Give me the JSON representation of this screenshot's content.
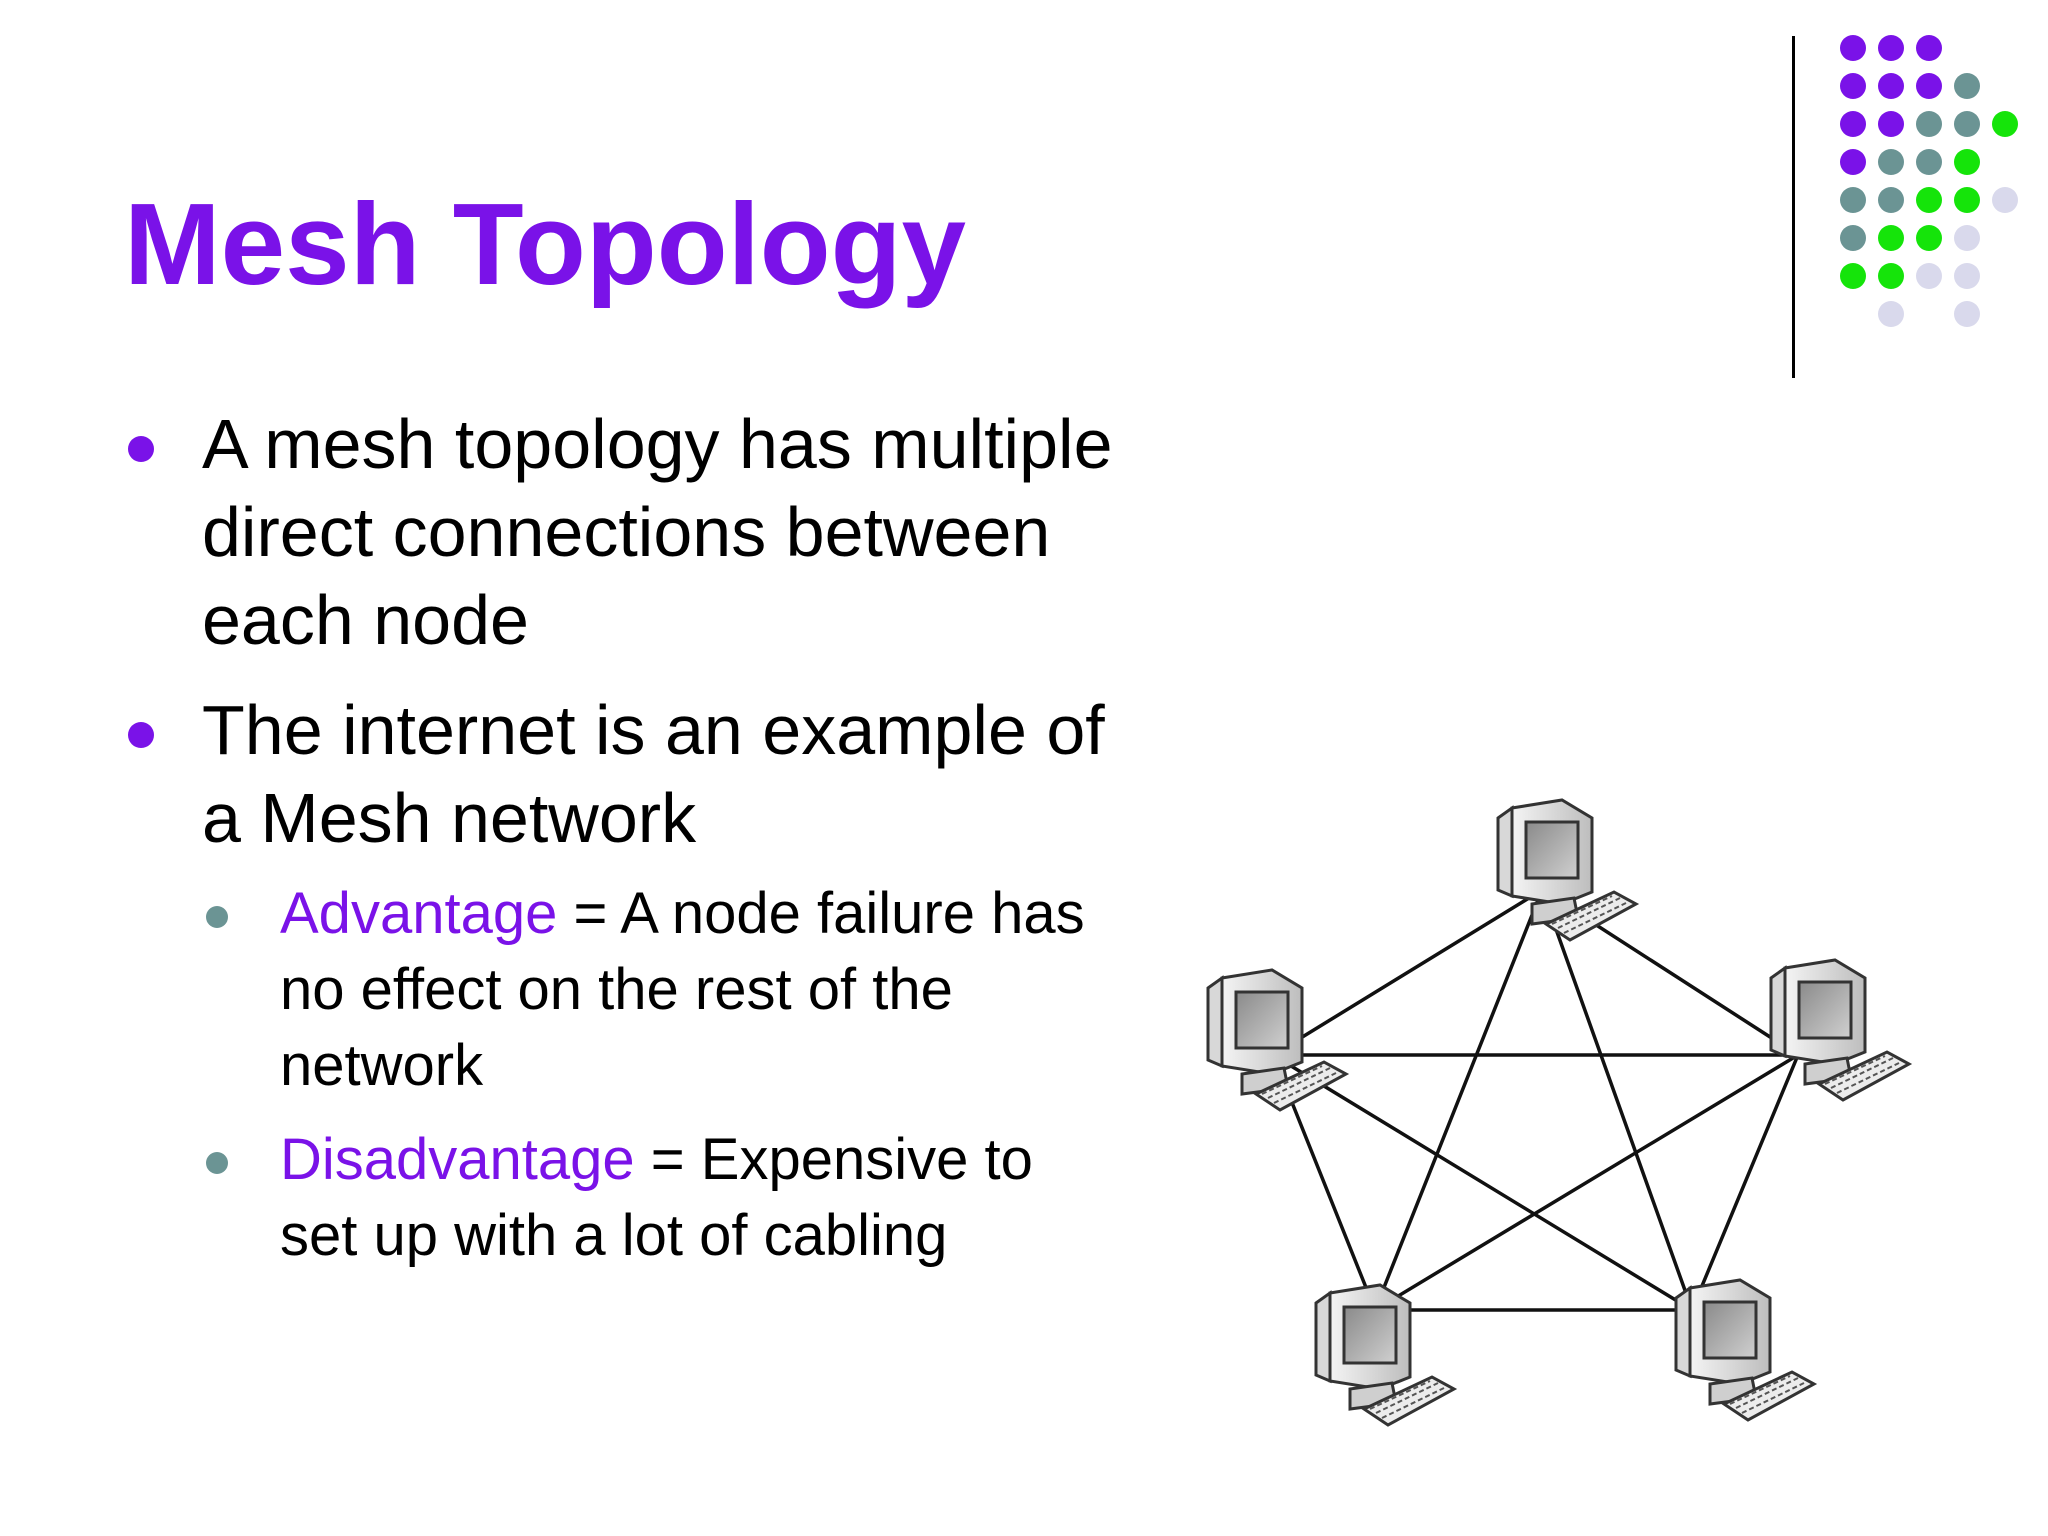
{
  "slide": {
    "title": "Mesh Topology",
    "bullets": [
      {
        "text": "A mesh topology has multiple direct connections between each node"
      },
      {
        "text": "The internet is an example of a Mesh network"
      }
    ],
    "sub_bullets": [
      {
        "term": "Advantage",
        "rest": " = A node failure has no effect on the rest of the network"
      },
      {
        "term": "Disadvantage",
        "rest": " = Expensive to set up with a lot of cabling"
      }
    ]
  },
  "colors": {
    "title": "#7a12e8",
    "purple": "#7a12e8",
    "teal": "#6b9494",
    "green": "#15e40a",
    "lavender": "#d9d9ec"
  },
  "diagram": {
    "node_icons": [
      "computer-icon",
      "computer-icon",
      "computer-icon",
      "computer-icon",
      "computer-icon"
    ],
    "topology": "full-mesh-pentagon"
  },
  "decoration": {
    "dot_grid": [
      [
        "purple",
        "purple",
        "purple",
        null,
        null
      ],
      [
        "purple",
        "purple",
        "purple",
        "teal",
        null
      ],
      [
        "purple",
        "purple",
        "teal",
        "teal",
        "green"
      ],
      [
        "purple",
        "teal",
        "teal",
        "green",
        null
      ],
      [
        "teal",
        "teal",
        "green",
        "green",
        "lavender"
      ],
      [
        "teal",
        "green",
        "green",
        "lavender",
        null
      ],
      [
        "green",
        "green",
        "lavender",
        "lavender",
        null
      ],
      [
        null,
        "lavender",
        null,
        "lavender",
        null
      ]
    ]
  }
}
